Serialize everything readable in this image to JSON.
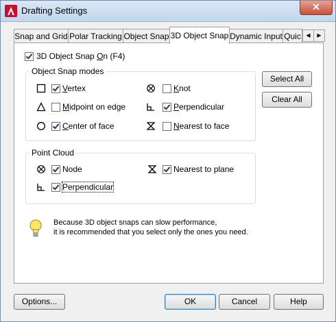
{
  "window": {
    "title": "Drafting Settings",
    "close_symbol": "✕"
  },
  "tabs": [
    {
      "label": "Snap and Grid"
    },
    {
      "label": "Polar Tracking"
    },
    {
      "label": "Object Snap"
    },
    {
      "label": "3D Object Snap",
      "active": true
    },
    {
      "label": "Dynamic Input"
    },
    {
      "label": "Quic"
    }
  ],
  "tab_scroll": {
    "left": "◀",
    "right": "▶"
  },
  "snap_on": {
    "label_prefix": "3D Object Snap ",
    "accel": "O",
    "label_suffix": "n (F4)",
    "checked": true
  },
  "object_snap_modes": {
    "title": "Object Snap modes",
    "items": [
      {
        "icon": "square-icon",
        "label": "Vertex",
        "accel": "V",
        "rest": "ertex",
        "checked": true
      },
      {
        "icon": "triangle-icon",
        "label": "Midpoint on edge",
        "accel": "M",
        "rest": "idpoint on edge",
        "checked": false
      },
      {
        "icon": "circle-icon",
        "label": "Center of face",
        "accel": "C",
        "rest": "enter of face",
        "checked": true
      },
      {
        "icon": "knot-icon",
        "label": "Knot",
        "accel": "K",
        "rest": "not",
        "checked": false
      },
      {
        "icon": "perpendicular-icon",
        "label": "Perpendicular",
        "accel": "P",
        "rest": "erpendicular",
        "checked": true
      },
      {
        "icon": "nearest-icon",
        "label": "Nearest to face",
        "accel": "N",
        "rest": "earest to face",
        "checked": false
      }
    ]
  },
  "point_cloud": {
    "title": "Point Cloud",
    "items": [
      {
        "icon": "node-icon",
        "label": "Node",
        "accel": "d",
        "checked": true
      },
      {
        "icon": "nearest-icon",
        "label": "Nearest to plane",
        "checked": true
      },
      {
        "icon": "perpendicular-icon",
        "label": "Perpendicular",
        "checked": true
      }
    ]
  },
  "buttons": {
    "select_all": "Select All",
    "clear_all": "Clear All",
    "options": "Options...",
    "ok": "OK",
    "cancel": "Cancel",
    "help": "Help"
  },
  "info": {
    "icon": "lightbulb-icon",
    "line1": "Because 3D object snaps can slow performance,",
    "line2": "it is recommended that you select only the ones you need."
  }
}
